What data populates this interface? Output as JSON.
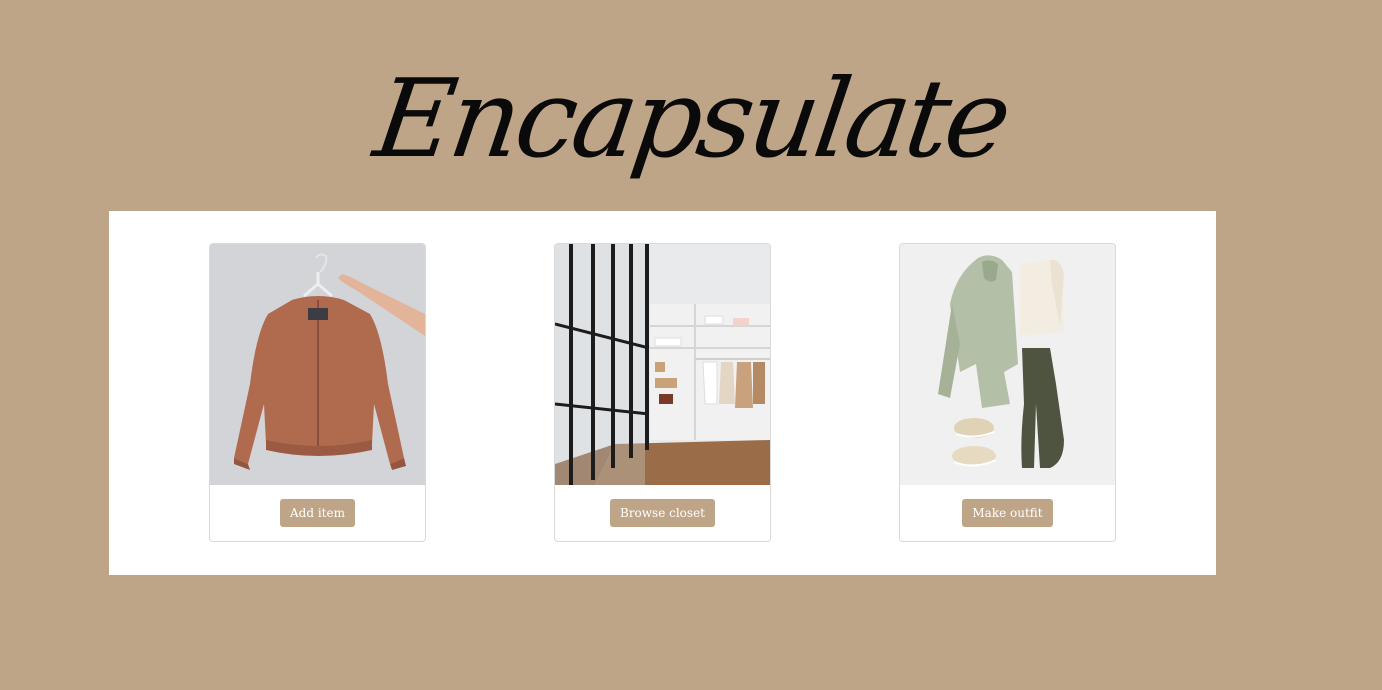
{
  "header": {
    "logo_text": "Encapsulate"
  },
  "cards": [
    {
      "button_label": "Add item",
      "image": "jacket-on-hanger-photo"
    },
    {
      "button_label": "Browse closet",
      "image": "walk-in-closet-photo"
    },
    {
      "button_label": "Make outfit",
      "image": "outfit-flatlay-photo"
    }
  ],
  "colors": {
    "background": "#bfa588",
    "panel": "#ffffff",
    "button": "#bfa588",
    "button_text": "#ffffff"
  }
}
